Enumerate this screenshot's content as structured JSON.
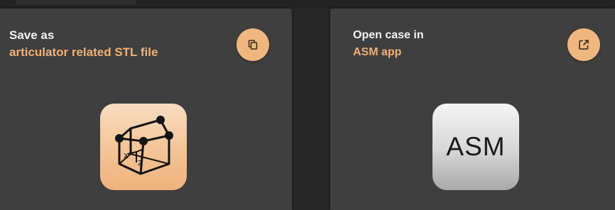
{
  "colors": {
    "background": "#272727",
    "card": "#3f3f3f",
    "accent": "#f0b074",
    "button": "#efb77e",
    "title_text": "#f2f2f2"
  },
  "cards": [
    {
      "title": "Save as",
      "subtitle": "articulator related STL file",
      "action_icon": "copy-icon",
      "app_icon": "stl-wireframe-cube-icon",
      "axis_labels": [
        "X",
        "Y",
        "Z"
      ]
    },
    {
      "title": "Open case in",
      "subtitle": "ASM app",
      "action_icon": "open-external-icon",
      "app_icon": "asm-app-icon",
      "app_icon_text": "ASM"
    }
  ]
}
